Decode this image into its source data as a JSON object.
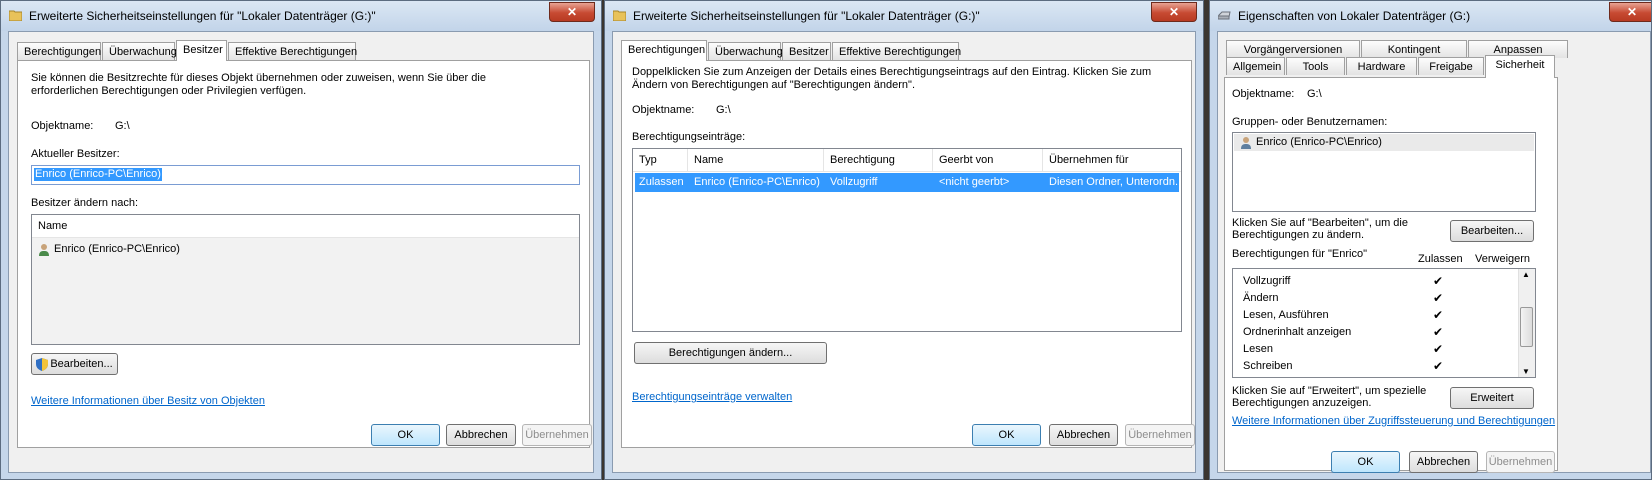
{
  "win1": {
    "title": "Erweiterte Sicherheitseinstellungen für \"Lokaler Datenträger (G:)\"",
    "tabs": [
      "Berechtigungen",
      "Überwachung",
      "Besitzer",
      "Effektive Berechtigungen"
    ],
    "selected_tab": "Besitzer",
    "intro": "Sie können die Besitzrechte für dieses Objekt übernehmen oder zuweisen, wenn Sie über die erforderlichen Berechtigungen oder Privilegien verfügen.",
    "object_label": "Objektname:",
    "object_value": "G:\\",
    "current_owner_label": "Aktueller Besitzer:",
    "current_owner_value": "Enrico (Enrico-PC\\Enrico)",
    "change_owner_label": "Besitzer ändern nach:",
    "list_header": "Name",
    "list_items": [
      "Enrico (Enrico-PC\\Enrico)"
    ],
    "edit_button": "Bearbeiten...",
    "info_link": "Weitere Informationen über Besitz von Objekten",
    "ok": "OK",
    "cancel": "Abbrechen",
    "apply": "Übernehmen"
  },
  "win2": {
    "title": "Erweiterte Sicherheitseinstellungen für \"Lokaler Datenträger (G:)\"",
    "tabs": [
      "Berechtigungen",
      "Überwachung",
      "Besitzer",
      "Effektive Berechtigungen"
    ],
    "selected_tab": "Berechtigungen",
    "intro": "Doppelklicken Sie zum Anzeigen der Details eines Berechtigungseintrags auf den Eintrag. Klicken Sie zum Ändern von Berechtigungen auf \"Berechtigungen ändern\".",
    "object_label": "Objektname:",
    "object_value": "G:\\",
    "entries_label": "Berechtigungseinträge:",
    "columns": [
      "Typ",
      "Name",
      "Berechtigung",
      "Geerbt von",
      "Übernehmen für"
    ],
    "rows": [
      {
        "typ": "Zulassen",
        "name": "Enrico (Enrico-PC\\Enrico)",
        "perm": "Vollzugriff",
        "inherited": "<nicht geerbt>",
        "applies": "Diesen Ordner, Unterordn..."
      }
    ],
    "change_button": "Berechtigungen ändern...",
    "manage_link": "Berechtigungseinträge verwalten",
    "ok": "OK",
    "cancel": "Abbrechen",
    "apply": "Übernehmen"
  },
  "win3": {
    "title": "Eigenschaften von Lokaler Datenträger (G:)",
    "tabs_row1": [
      "Vorgängerversionen",
      "Kontingent",
      "Anpassen"
    ],
    "tabs_row2": [
      "Allgemein",
      "Tools",
      "Hardware",
      "Freigabe",
      "Sicherheit"
    ],
    "selected_tab": "Sicherheit",
    "object_label": "Objektname:",
    "object_value": "G:\\",
    "groups_label": "Gruppen- oder Benutzernamen:",
    "groups": [
      "Enrico (Enrico-PC\\Enrico)"
    ],
    "edit_text": "Klicken Sie auf \"Bearbeiten\", um die Berechtigungen zu ändern.",
    "edit_button": "Bearbeiten...",
    "perm_label": "Berechtigungen für \"Enrico\"",
    "allow_label": "Zulassen",
    "deny_label": "Verweigern",
    "permissions": [
      {
        "name": "Vollzugriff",
        "allow": "✔",
        "deny": ""
      },
      {
        "name": "Ändern",
        "allow": "✔",
        "deny": ""
      },
      {
        "name": "Lesen, Ausführen",
        "allow": "✔",
        "deny": ""
      },
      {
        "name": "Ordnerinhalt anzeigen",
        "allow": "✔",
        "deny": ""
      },
      {
        "name": "Lesen",
        "allow": "✔",
        "deny": ""
      },
      {
        "name": "Schreiben",
        "allow": "✔",
        "deny": ""
      }
    ],
    "advanced_text": "Klicken Sie auf \"Erweitert\", um spezielle Berechtigungen anzuzeigen.",
    "advanced_button": "Erweitert",
    "info_link": "Weitere Informationen über Zugriffssteuerung und Berechtigungen",
    "ok": "OK",
    "cancel": "Abbrechen",
    "apply": "Übernehmen"
  },
  "icons": {
    "folder": "folder-icon",
    "drive": "drive-icon",
    "user": "user-icon",
    "shield": "uac-shield-icon",
    "close": "close-icon",
    "check": "checkmark-icon"
  }
}
